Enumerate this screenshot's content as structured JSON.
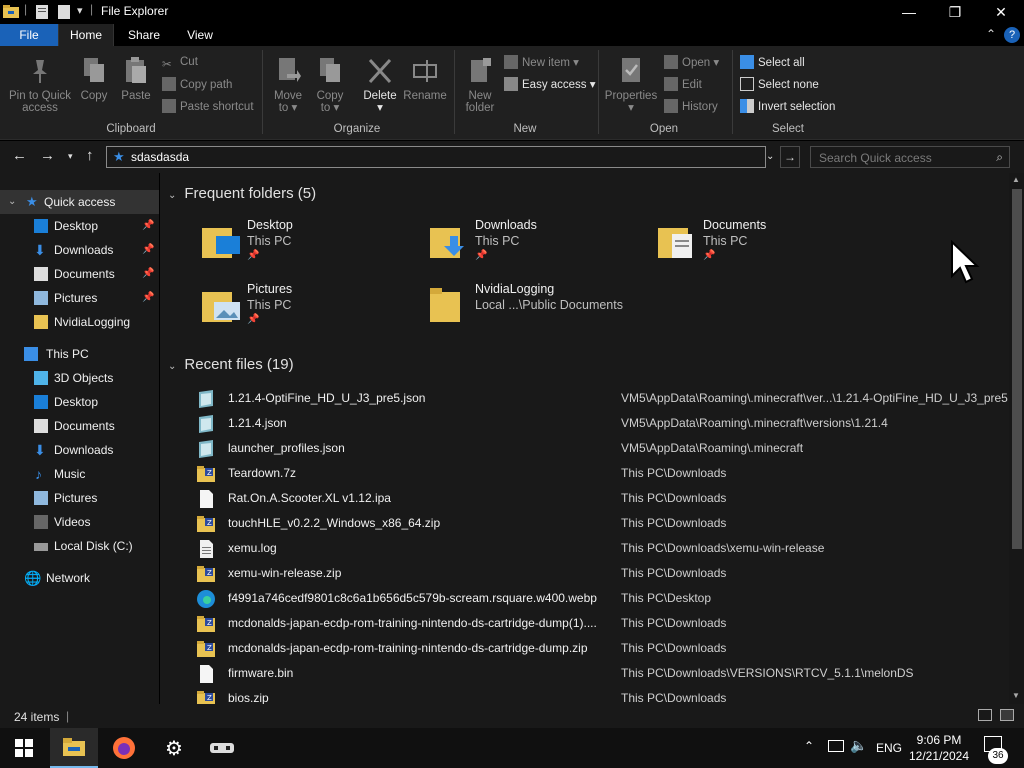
{
  "window": {
    "title": "File Explorer",
    "controls": {
      "minimize": "—",
      "maximize": "❐",
      "close": "✕"
    }
  },
  "ribbon_tabs": [
    "File",
    "Home",
    "Share",
    "View"
  ],
  "ribbon": {
    "clipboard": {
      "label": "Clipboard",
      "pin_to_quick_access": [
        "Pin to Quick",
        "access"
      ],
      "copy": "Copy",
      "paste": "Paste",
      "cut": "Cut",
      "copy_path": "Copy path",
      "paste_shortcut": "Paste shortcut"
    },
    "organize": {
      "label": "Organize",
      "move_to": [
        "Move",
        "to ▾"
      ],
      "copy_to": [
        "Copy",
        "to ▾"
      ],
      "delete": [
        "Delete",
        "▾"
      ],
      "rename": "Rename"
    },
    "new": {
      "label": "New",
      "new_folder": [
        "New",
        "folder"
      ],
      "new_item": "New item ▾",
      "easy_access": "Easy access ▾"
    },
    "open": {
      "label": "Open",
      "properties": [
        "Properties",
        "▾"
      ],
      "open": "Open ▾",
      "edit": "Edit",
      "history": "History"
    },
    "select": {
      "label": "Select",
      "select_all": "Select all",
      "select_none": "Select none",
      "invert_selection": "Invert selection"
    }
  },
  "address": {
    "path": "sdasdasda",
    "search_placeholder": "Search Quick access"
  },
  "nav": {
    "quick_access": "Quick access",
    "pinned": [
      {
        "label": "Desktop",
        "pinned": true
      },
      {
        "label": "Downloads",
        "pinned": true
      },
      {
        "label": "Documents",
        "pinned": true
      },
      {
        "label": "Pictures",
        "pinned": true
      },
      {
        "label": "NvidiaLogging",
        "pinned": false
      }
    ],
    "this_pc": "This PC",
    "pc_items": [
      "3D Objects",
      "Desktop",
      "Documents",
      "Downloads",
      "Music",
      "Pictures",
      "Videos",
      "Local Disk (C:)"
    ],
    "network": "Network"
  },
  "frequent": {
    "header": "Frequent folders (5)",
    "folders": [
      {
        "name": "Desktop",
        "location": "This PC",
        "pinned": true
      },
      {
        "name": "Downloads",
        "location": "This PC",
        "pinned": true
      },
      {
        "name": "Documents",
        "location": "This PC",
        "pinned": true
      },
      {
        "name": "Pictures",
        "location": "This PC",
        "pinned": true
      },
      {
        "name": "NvidiaLogging",
        "location": "Local ...\\Public Documents",
        "pinned": false
      }
    ]
  },
  "recent": {
    "header": "Recent files (19)",
    "files": [
      {
        "name": "1.21.4-OptiFine_HD_U_J3_pre5.json",
        "path": "VM5\\AppData\\Roaming\\.minecraft\\ver...\\1.21.4-OptiFine_HD_U_J3_pre5",
        "icon": "json"
      },
      {
        "name": "1.21.4.json",
        "path": "VM5\\AppData\\Roaming\\.minecraft\\versions\\1.21.4",
        "icon": "json"
      },
      {
        "name": "launcher_profiles.json",
        "path": "VM5\\AppData\\Roaming\\.minecraft",
        "icon": "json"
      },
      {
        "name": "Teardown.7z",
        "path": "This PC\\Downloads",
        "icon": "archive"
      },
      {
        "name": "Rat.On.A.Scooter.XL v1.12.ipa",
        "path": "This PC\\Downloads",
        "icon": "blank"
      },
      {
        "name": "touchHLE_v0.2.2_Windows_x86_64.zip",
        "path": "This PC\\Downloads",
        "icon": "archive"
      },
      {
        "name": "xemu.log",
        "path": "This PC\\Downloads\\xemu-win-release",
        "icon": "text"
      },
      {
        "name": "xemu-win-release.zip",
        "path": "This PC\\Downloads",
        "icon": "archive"
      },
      {
        "name": "f4991a746cedf9801c8c6a1b656d5c579b-scream.rsquare.w400.webp",
        "path": "This PC\\Desktop",
        "icon": "edge"
      },
      {
        "name": "mcdonalds-japan-ecdp-rom-training-nintendo-ds-cartridge-dump(1)....",
        "path": "This PC\\Downloads",
        "icon": "archive"
      },
      {
        "name": "mcdonalds-japan-ecdp-rom-training-nintendo-ds-cartridge-dump.zip",
        "path": "This PC\\Downloads",
        "icon": "archive"
      },
      {
        "name": "firmware.bin",
        "path": "This PC\\Downloads\\VERSIONS\\RTCV_5.1.1\\melonDS",
        "icon": "blank"
      },
      {
        "name": "bios.zip",
        "path": "This PC\\Downloads",
        "icon": "archive"
      }
    ]
  },
  "status": {
    "items": "24 items"
  },
  "taskbar": {
    "time": "9:06 PM",
    "date": "12/21/2024",
    "language": "ENG",
    "notifications": "36"
  },
  "colors": {
    "accent": "#1a62b8",
    "folder": "#e8c252",
    "background": "#191919"
  }
}
